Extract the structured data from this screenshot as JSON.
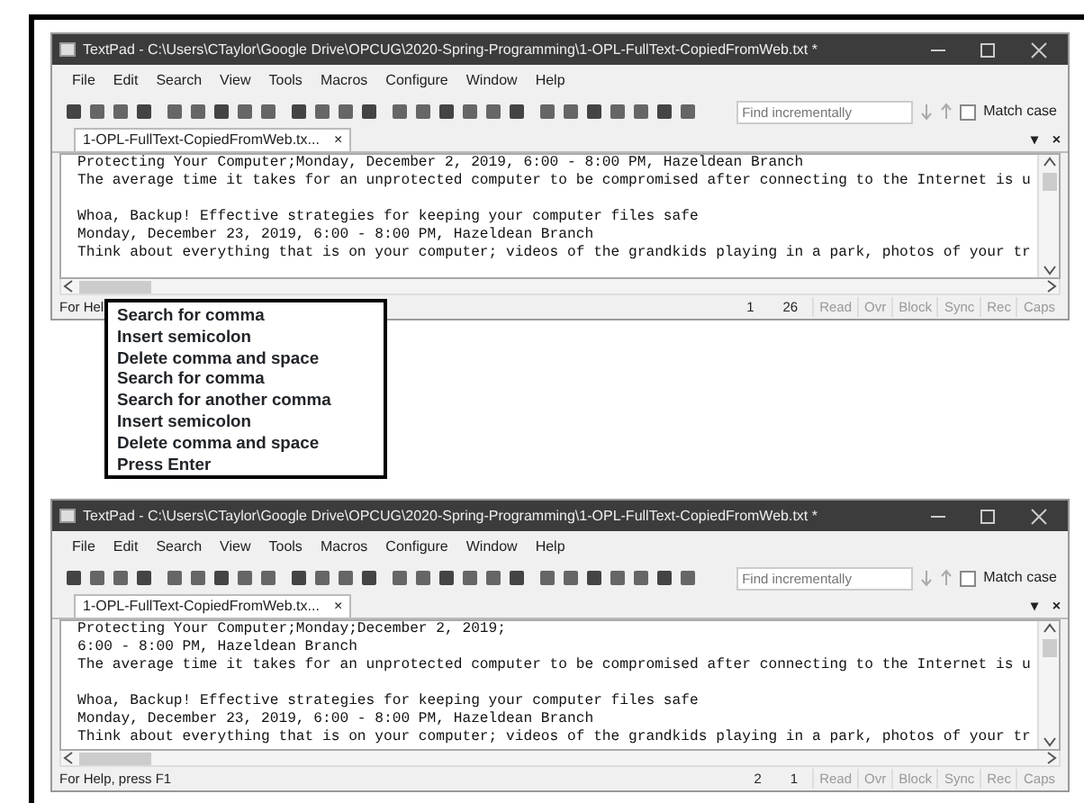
{
  "windows": [
    {
      "title": "TextPad - C:\\Users\\CTaylor\\Google Drive\\OPCUG\\2020-Spring-Programming\\1-OPL-FullText-CopiedFromWeb.txt *",
      "menu": [
        "File",
        "Edit",
        "Search",
        "View",
        "Tools",
        "Macros",
        "Configure",
        "Window",
        "Help"
      ],
      "find": {
        "placeholder": "Find incrementally"
      },
      "match_case": {
        "label": "Match case",
        "checked": false
      },
      "tab": {
        "label": "1-OPL-FullText-CopiedFromWeb.tx...",
        "close": "×"
      },
      "tab_controls": [
        "▾",
        "×"
      ],
      "paragraphs": [
        {
          "lines": [
            "Protecting Your Computer;Monday, December 2, 2019, 6:00 - 8:00 PM, Hazeldean Branch",
            "The average time it takes for an unprotected computer to be compromised after connecting to the Internet is u"
          ]
        },
        {
          "lines": [
            "Whoa, Backup! Effective strategies for keeping your computer files safe",
            "Monday, December 23, 2019, 6:00 - 8:00 PM, Hazeldean Branch",
            "Think about everything that is on your computer; videos of the grandkids playing in a park, photos of your tr"
          ]
        }
      ],
      "status": {
        "help": "For Hel",
        "line": "1",
        "column": "26",
        "indicators": [
          {
            "label": "Read",
            "active": false
          },
          {
            "label": "Ovr",
            "active": false
          },
          {
            "label": "Block",
            "active": false
          },
          {
            "label": "Sync",
            "active": false
          },
          {
            "label": "Rec",
            "active": false
          },
          {
            "label": "Caps",
            "active": false
          }
        ]
      }
    },
    {
      "title": "TextPad - C:\\Users\\CTaylor\\Google Drive\\OPCUG\\2020-Spring-Programming\\1-OPL-FullText-CopiedFromWeb.txt *",
      "menu": [
        "File",
        "Edit",
        "Search",
        "View",
        "Tools",
        "Macros",
        "Configure",
        "Window",
        "Help"
      ],
      "find": {
        "placeholder": "Find incrementally"
      },
      "match_case": {
        "label": "Match case",
        "checked": false
      },
      "tab": {
        "label": "1-OPL-FullText-CopiedFromWeb.tx...",
        "close": "×"
      },
      "tab_controls": [
        "▾",
        "×"
      ],
      "paragraphs": [
        {
          "lines": [
            "Protecting Your Computer;Monday;December 2, 2019;",
            "6:00 - 8:00 PM, Hazeldean Branch",
            "The average time it takes for an unprotected computer to be compromised after connecting to the Internet is u"
          ]
        },
        {
          "lines": [
            "Whoa, Backup! Effective strategies for keeping your computer files safe",
            "Monday, December 23, 2019, 6:00 - 8:00 PM, Hazeldean Branch",
            "Think about everything that is on your computer; videos of the grandkids playing in a park, photos of your tr"
          ]
        }
      ],
      "status": {
        "help": "For Help, press F1",
        "line": "2",
        "column": "1",
        "indicators": [
          {
            "label": "Read",
            "active": false
          },
          {
            "label": "Ovr",
            "active": false
          },
          {
            "label": "Block",
            "active": false
          },
          {
            "label": "Sync",
            "active": false
          },
          {
            "label": "Rec",
            "active": false
          },
          {
            "label": "Caps",
            "active": false
          }
        ]
      }
    }
  ],
  "callout": {
    "steps": [
      "Search for comma",
      "Insert semicolon",
      "Delete comma and space",
      "Search for comma",
      "Search for another comma",
      "Insert semicolon",
      "Delete comma and space",
      "Press Enter"
    ]
  }
}
